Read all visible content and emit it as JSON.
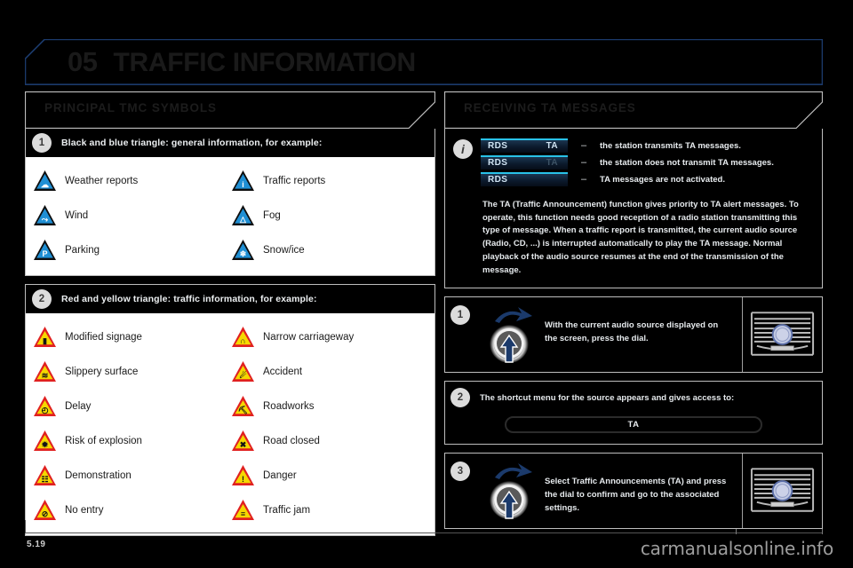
{
  "chapter": {
    "number": "05",
    "title": "TRAFFIC INFORMATION"
  },
  "left_column": {
    "section_title": "PRINCIPAL TMC SYMBOLS",
    "groups": [
      {
        "badge": "1",
        "heading": "Black and blue triangle: general information, for example:",
        "style": "blue",
        "items": [
          {
            "label": "Weather reports",
            "icon": "weather-triangle-icon",
            "glyph": "☁"
          },
          {
            "label": "Traffic reports",
            "icon": "info-triangle-icon",
            "glyph": "i"
          },
          {
            "label": "Wind",
            "icon": "wind-triangle-icon",
            "glyph": "⤳"
          },
          {
            "label": "Fog",
            "icon": "fog-triangle-icon",
            "glyph": "△"
          },
          {
            "label": "Parking",
            "icon": "parking-triangle-icon",
            "glyph": "P"
          },
          {
            "label": "Snow/ice",
            "icon": "snow-triangle-icon",
            "glyph": "❄"
          }
        ]
      },
      {
        "badge": "2",
        "heading": "Red and yellow triangle: traffic information, for example:",
        "style": "yellow",
        "items": [
          {
            "label": "Modified signage",
            "icon": "traffic-light-triangle-icon",
            "glyph": "▮"
          },
          {
            "label": "Narrow carriageway",
            "icon": "narrow-road-triangle-icon",
            "glyph": "∩"
          },
          {
            "label": "Slippery surface",
            "icon": "slippery-triangle-icon",
            "glyph": "≋"
          },
          {
            "label": "Accident",
            "icon": "accident-triangle-icon",
            "glyph": "☄"
          },
          {
            "label": "Delay",
            "icon": "delay-triangle-icon",
            "glyph": "◴"
          },
          {
            "label": "Roadworks",
            "icon": "roadworks-triangle-icon",
            "glyph": "⛏"
          },
          {
            "label": "Risk of explosion",
            "icon": "explosion-triangle-icon",
            "glyph": "✹"
          },
          {
            "label": "Road closed",
            "icon": "road-closed-triangle-icon",
            "glyph": "✖"
          },
          {
            "label": "Demonstration",
            "icon": "demonstration-triangle-icon",
            "glyph": "☷"
          },
          {
            "label": "Danger",
            "icon": "danger-triangle-icon",
            "glyph": "!"
          },
          {
            "label": "No entry",
            "icon": "no-entry-triangle-icon",
            "glyph": "⊘"
          },
          {
            "label": "Traffic jam",
            "icon": "traffic-jam-triangle-icon",
            "glyph": "≡"
          }
        ]
      }
    ]
  },
  "right_column": {
    "section_title": "RECEIVING TA MESSAGES",
    "rds_states": [
      {
        "left": "RDS",
        "right": "TA",
        "left_on": true,
        "right_on": true,
        "dash": "–",
        "desc": "the station transmits TA messages."
      },
      {
        "left": "RDS",
        "right": "TA",
        "left_on": true,
        "right_on": false,
        "dash": "–",
        "desc": "the station does not transmit TA messages."
      },
      {
        "left": "RDS",
        "right": "",
        "left_on": true,
        "right_on": false,
        "dash": "–",
        "desc": "TA messages are not activated."
      }
    ],
    "paragraph": "The TA (Traffic Announcement) function gives priority to TA alert messages. To operate, this function needs good reception of a radio station transmitting this type of message. When a traffic report is transmitted, the current audio source (Radio, CD, ...) is interrupted automatically to play the TA message. Normal playback of the audio source resumes at the end of the transmission of the message.",
    "steps": [
      {
        "badge": "1",
        "text": "With the current audio source displayed on the screen, press the dial.",
        "has_radio_image": true,
        "dial_icon": "press-dial-icon"
      },
      {
        "badge": "2",
        "text": "The shortcut menu for the source appears and gives access to:",
        "pill_label": "TA",
        "has_radio_image": false
      },
      {
        "badge": "3",
        "text": "Select Traffic Announcements (TA) and press the dial to confirm and go to the associated settings.",
        "has_radio_image": true,
        "dial_icon": "press-dial-icon"
      }
    ]
  },
  "footer": {
    "page_number": "5.19",
    "watermark": "carmanualsonline.info"
  },
  "colors": {
    "accent_blue": "#1b3a6b",
    "triangle_blue": "#1f8fd4",
    "triangle_yellow": "#f5d800",
    "triangle_red": "#e02020",
    "chip_cyan": "#29c2e8",
    "frame_grey": "#bdbdbd"
  }
}
